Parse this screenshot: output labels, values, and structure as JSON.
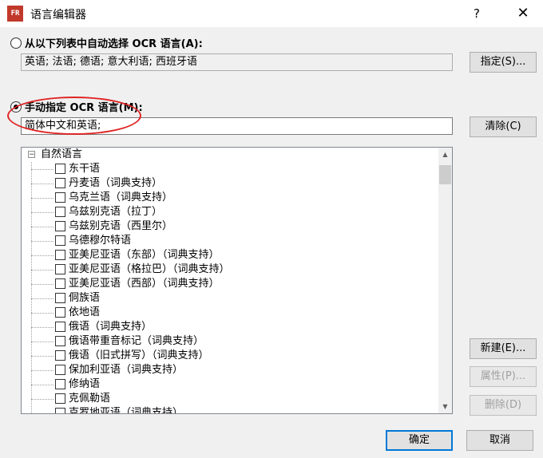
{
  "window": {
    "title": "语言编辑器",
    "app_icon_text": "FR",
    "help": "?",
    "close": "✕"
  },
  "auto": {
    "label": "从以下列表中自动选择 OCR 语言(A):",
    "value": "英语; 法语; 德语; 意大利语; 西班牙语",
    "button": "指定(S)...",
    "checked": false
  },
  "manual": {
    "label": "手动指定 OCR 语言(M):",
    "value": "简体中文和英语;",
    "button": "清除(C)",
    "checked": true
  },
  "tree": {
    "root": "自然语言",
    "expander": "−",
    "items": [
      "东干语",
      "丹麦语（词典支持）",
      "乌克兰语（词典支持）",
      "乌兹别克语（拉丁）",
      "乌兹别克语（西里尔）",
      "乌德穆尔特语",
      "亚美尼亚语（东部）（词典支持）",
      "亚美尼亚语（格拉巴）（词典支持）",
      "亚美尼亚语（西部）（词典支持）",
      "侗族语",
      "依地语",
      "俄语（词典支持）",
      "俄语带重音标记（词典支持）",
      "俄语（旧式拼写）（词典支持）",
      "保加利亚语（词典支持）",
      "修纳语",
      "克佩勒语",
      "克罗地亚语（词典支持）"
    ]
  },
  "side_buttons": {
    "new": "新建(E)...",
    "properties": "属性(P)...",
    "delete": "删除(D)"
  },
  "footer": {
    "ok": "确定",
    "cancel": "取消"
  },
  "colors": {
    "annotation": "#e02424",
    "default_button_border": "#0078d7"
  }
}
